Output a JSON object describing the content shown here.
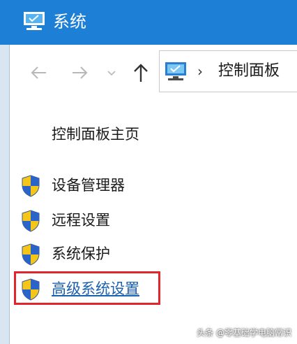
{
  "window": {
    "title": "系统"
  },
  "toolbar": {
    "back_icon": "arrow-left-icon",
    "forward_icon": "arrow-right-icon",
    "recent_icon": "chevron-down-icon",
    "up_icon": "arrow-up-icon"
  },
  "address": {
    "separator": "›",
    "crumb": "控制面板"
  },
  "sidebar": {
    "home": "控制面板主页",
    "tasks": [
      {
        "label": "设备管理器",
        "icon": "shield-icon"
      },
      {
        "label": "远程设置",
        "icon": "shield-icon"
      },
      {
        "label": "系统保护",
        "icon": "shield-icon"
      },
      {
        "label": "高级系统设置",
        "icon": "shield-icon",
        "highlighted": true
      }
    ]
  },
  "watermark": "头条 @零基础学电脑常识",
  "colors": {
    "titlebar": "#1e7fd6",
    "highlight_box": "#e0262c",
    "link": "#1a5fb0"
  }
}
